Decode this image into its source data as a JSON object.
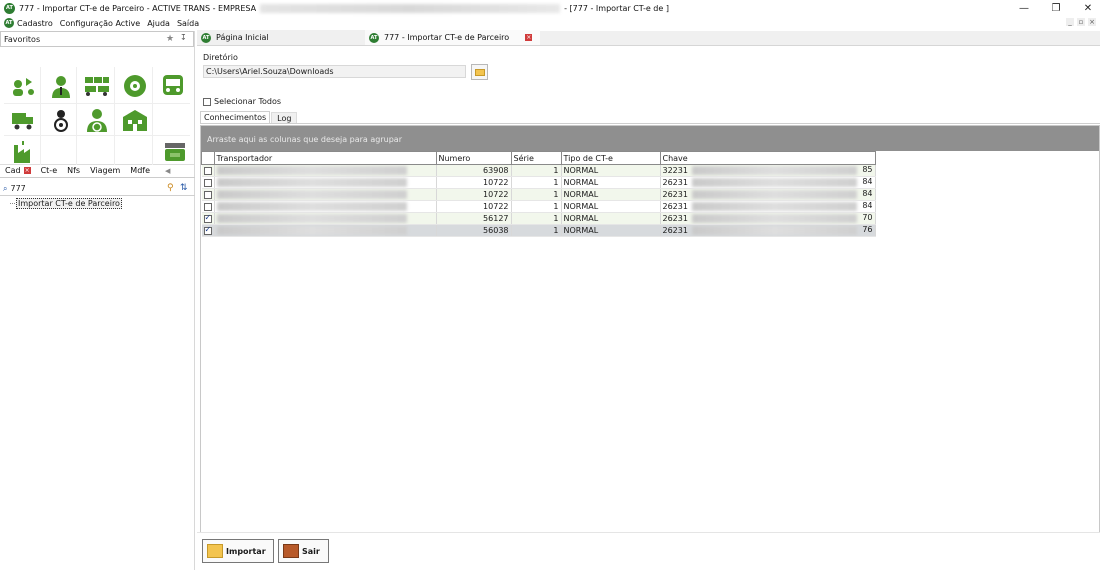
{
  "window": {
    "title_prefix": "777 - Importar CT-e de Parceiro - ACTIVE TRANS - EMPRESA",
    "title_suffix": "- [777 - Importar CT-e de ]",
    "minimize": "—",
    "restore": "❐",
    "close": "✕"
  },
  "logo_text": "AT",
  "menu": [
    "Cadastro",
    "Configuração Active",
    "Ajuda",
    "Saída"
  ],
  "mdi": {
    "minimize": "_",
    "restore": "▫",
    "close": "×"
  },
  "left_panel": {
    "favorites_label": "Favoritos",
    "favorites_pin": "↧",
    "favorites_star": "★",
    "tabs": [
      {
        "label": "Cad",
        "closable": true
      },
      {
        "label": "Ct-e"
      },
      {
        "label": "Nfs"
      },
      {
        "label": "Viagem"
      },
      {
        "label": "Mdfe"
      }
    ],
    "tabs_arrow": "◀",
    "search_value": "777",
    "tree_item": "Importar CT-e de Parceiro"
  },
  "doc_tabs": [
    {
      "label": "Página Inicial",
      "active": false
    },
    {
      "label": "777 - Importar CT-e de Parceiro",
      "active": true
    }
  ],
  "form": {
    "dir_label": "Diretório",
    "dir_value": "C:\\Users\\Ariel.Souza\\Downloads",
    "select_all_label": "Selecionar Todos",
    "subtabs": [
      "Conhecimentos",
      "Log"
    ],
    "group_hint": "Arraste aqui as colunas que deseja para agrupar"
  },
  "grid": {
    "columns": [
      "Transportador",
      "Numero",
      "Série",
      "Tipo de CT-e",
      "Chave"
    ],
    "rows": [
      {
        "checked": false,
        "transportador": "",
        "numero": "63908",
        "serie": "1",
        "tipo": "NORMAL",
        "chave_start": "32231",
        "chave_end": "85"
      },
      {
        "checked": false,
        "transportador": "",
        "numero": "10722",
        "serie": "1",
        "tipo": "NORMAL",
        "chave_start": "26231",
        "chave_end": "84"
      },
      {
        "checked": false,
        "transportador": "",
        "numero": "10722",
        "serie": "1",
        "tipo": "NORMAL",
        "chave_start": "26231",
        "chave_end": "84"
      },
      {
        "checked": false,
        "transportador": "",
        "numero": "10722",
        "serie": "1",
        "tipo": "NORMAL",
        "chave_start": "26231",
        "chave_end": "84"
      },
      {
        "checked": true,
        "transportador": "",
        "numero": "56127",
        "serie": "1",
        "tipo": "NORMAL",
        "chave_start": "26231",
        "chave_end": "70"
      },
      {
        "checked": true,
        "transportador": "",
        "numero": "56038",
        "serie": "1",
        "tipo": "NORMAL",
        "chave_start": "26231",
        "chave_end": "76"
      }
    ]
  },
  "buttons": {
    "import": "Importar",
    "exit": "Sair"
  },
  "colors": {
    "logo_green": "#2e7d32",
    "icon_green": "#4e9a2c",
    "group_bar": "#8f8f8f",
    "row_tint": "#f2f7ec"
  }
}
